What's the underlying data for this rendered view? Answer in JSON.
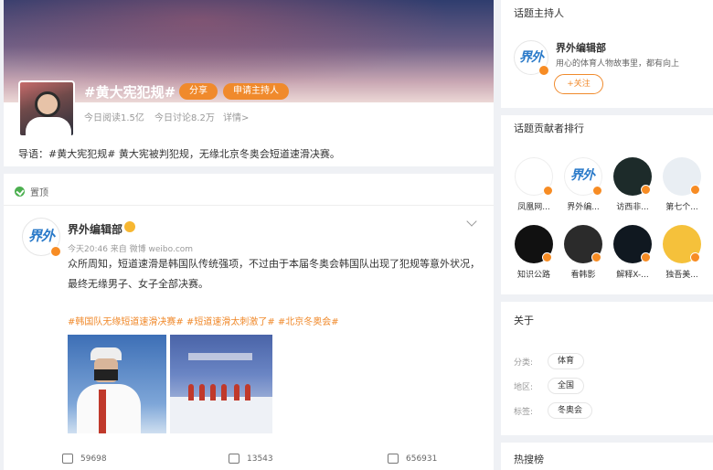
{
  "topic": {
    "title": "#黄大宪犯规#",
    "share_label": "分享",
    "host_label": "申请主持人",
    "read_count": "今日阅读1.5亿",
    "discuss_count": "今日讨论8.2万",
    "detail_label": "详情>",
    "intro": "导语：#黄大宪犯规# 黄大宪被判犯规，无缘北京冬奥会短道速滑决赛。"
  },
  "post": {
    "pin_label": "置顶",
    "author": "界外编辑部",
    "meta": "今天20:46 来自 微博 weibo.com",
    "text": "众所周知，短道速滑是韩国队传统强项，不过由于本届冬奥会韩国队出现了犯规等意外状况，最终无缘男子、女子全部决赛。",
    "tags": "#韩国队无缘短道速滑决赛# #短道速滑太刺激了# #北京冬奥会#",
    "repost_count": "59698",
    "comment_count": "13543",
    "like_count": "656931"
  },
  "host": {
    "section_title": "话题主持人",
    "logo_text": "界外",
    "name": "界外编辑部",
    "desc": "用心的体育人物故事里，都有向上",
    "follow_label": "+关注"
  },
  "contributors": {
    "section_title": "话题贡献者排行",
    "items": [
      {
        "name": "凤凰网...",
        "color": "#ffffff"
      },
      {
        "name": "界外编...",
        "color": "#ffffff"
      },
      {
        "name": "访西非...",
        "color": "#1d2b2a"
      },
      {
        "name": "第七个...",
        "color": "#e9eef3"
      },
      {
        "name": "知识公路",
        "color": "#111111"
      },
      {
        "name": "看韩影",
        "color": "#2b2b2b"
      },
      {
        "name": "解释X-...",
        "color": "#101820"
      },
      {
        "name": "独吾美...",
        "color": "#f5c13b"
      }
    ]
  },
  "about": {
    "section_title": "关于",
    "category_label": "分类:",
    "category_value": "体育",
    "region_label": "地区:",
    "region_value": "全国",
    "tag_label": "标签:",
    "tag_value": "冬奥会"
  },
  "hot": {
    "section_title": "热搜榜"
  },
  "colors": {
    "accent_orange": "#f08a2c",
    "page_bg": "#eff1f5"
  }
}
